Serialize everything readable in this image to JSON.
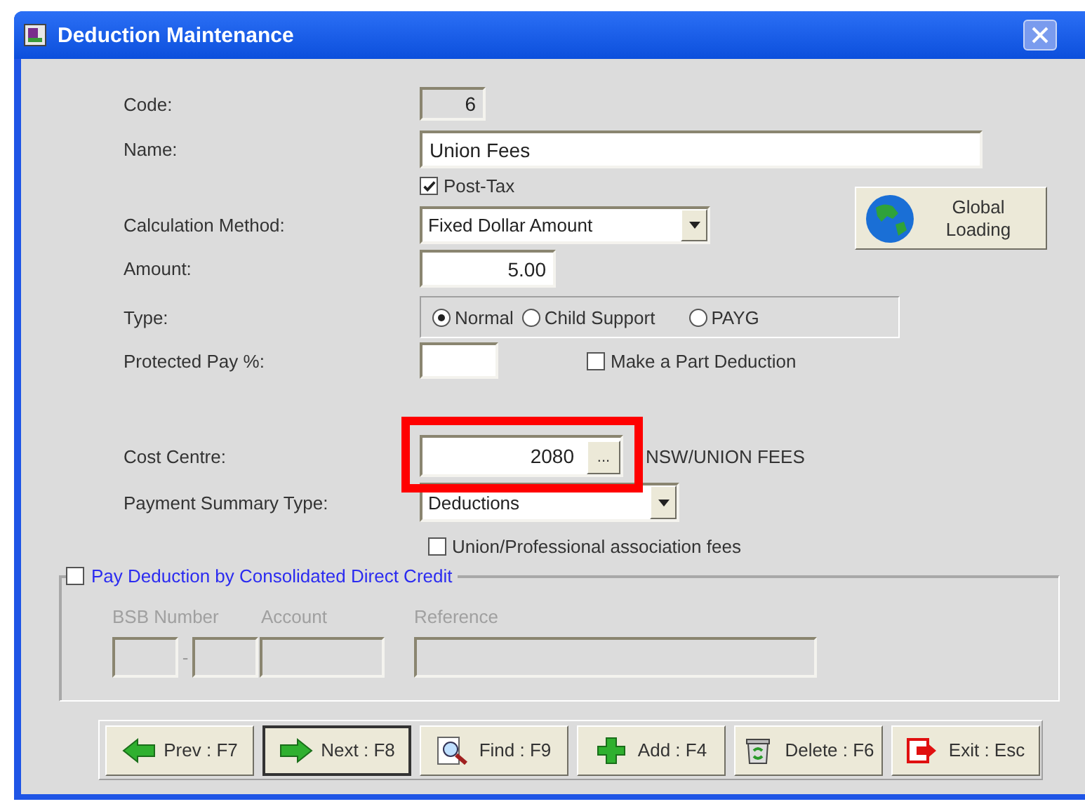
{
  "window": {
    "title": "Deduction Maintenance"
  },
  "form": {
    "code": {
      "label": "Code:",
      "value": "6"
    },
    "name": {
      "label": "Name:",
      "value": "Union Fees"
    },
    "post_tax": {
      "label": "Post-Tax",
      "checked": true
    },
    "calculation_method": {
      "label": "Calculation Method:",
      "value": "Fixed Dollar Amount"
    },
    "global_loading": {
      "label": "Global Loading"
    },
    "amount": {
      "label": "Amount:",
      "value": "5.00"
    },
    "type": {
      "label": "Type:",
      "options": [
        {
          "label": "Normal",
          "selected": true
        },
        {
          "label": "Child Support",
          "selected": false
        },
        {
          "label": "PAYG",
          "selected": false
        }
      ]
    },
    "protected_pay": {
      "label": "Protected Pay %:"
    },
    "part_deduction": {
      "label": "Make a Part Deduction",
      "checked": false
    },
    "cost_centre": {
      "label": "Cost Centre:",
      "value": "2080",
      "lookup": "...",
      "description": "NSW/UNION FEES",
      "highlighted": true
    },
    "payment_summary_type": {
      "label": "Payment Summary Type:",
      "value": "Deductions"
    },
    "union_fees": {
      "label": "Union/Professional association fees",
      "checked": false
    },
    "direct_credit": {
      "label": "Pay Deduction by Consolidated Direct Credit",
      "checked": false,
      "bsb_label": "BSB Number",
      "account_label": "Account",
      "reference_label": "Reference",
      "separator": "-",
      "disabled": true
    }
  },
  "toolbar": [
    {
      "label": "Prev : F7",
      "kind": "prev",
      "default": false
    },
    {
      "label": "Next : F8",
      "kind": "next",
      "default": true
    },
    {
      "label": "Find : F9",
      "kind": "find",
      "default": false
    },
    {
      "label": "Add : F4",
      "kind": "add",
      "default": false
    },
    {
      "label": "Delete : F6",
      "kind": "delete",
      "default": false
    },
    {
      "label": "Exit : Esc",
      "kind": "exit",
      "default": false
    }
  ]
}
